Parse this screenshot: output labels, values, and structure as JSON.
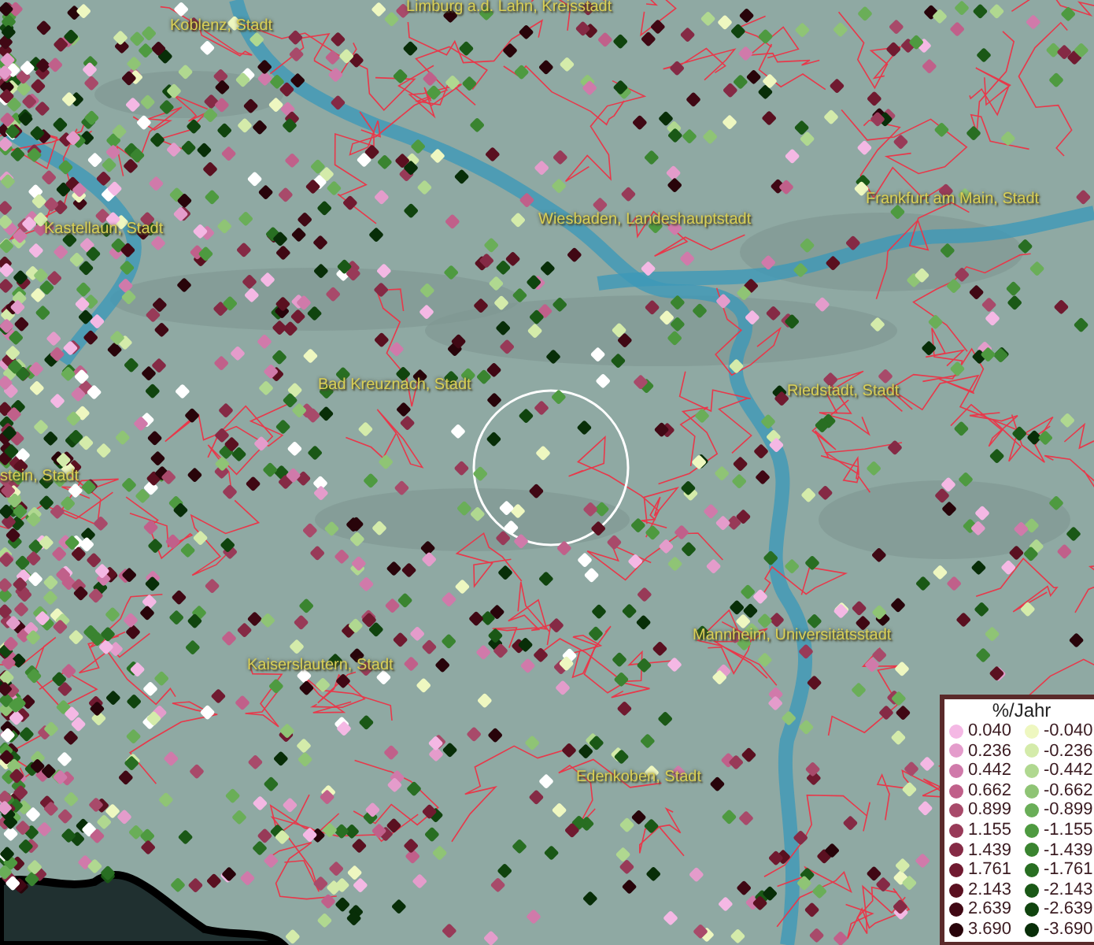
{
  "map": {
    "place_labels": [
      {
        "text": "Koblenz, Stadt"
      },
      {
        "text": "Limburg a.d. Lahn, Kreisstadt"
      },
      {
        "text": "Kastellaun, Stadt"
      },
      {
        "text": "Wiesbaden, Landeshauptstadt"
      },
      {
        "text": "Frankfurt am Main, Stadt"
      },
      {
        "text": "Bad Kreuznach, Stadt"
      },
      {
        "text": "Riedstadt, Stadt"
      },
      {
        "text": "stein, Stadt"
      },
      {
        "text": "Mannheim, Universitätsstadt"
      },
      {
        "text": "Kaiserslautern, Stadt"
      },
      {
        "text": "Edenkoben, Stadt"
      }
    ]
  },
  "legend": {
    "title": "%/Jahr",
    "positive": [
      {
        "label": "0.040",
        "color": "#f4b8e4"
      },
      {
        "label": "0.236",
        "color": "#e49ccb"
      },
      {
        "label": "0.442",
        "color": "#d07aaa"
      },
      {
        "label": "0.662",
        "color": "#c0608a"
      },
      {
        "label": "0.899",
        "color": "#a84a6a"
      },
      {
        "label": "1.155",
        "color": "#983a58"
      },
      {
        "label": "1.439",
        "color": "#852a45"
      },
      {
        "label": "1.761",
        "color": "#701a30"
      },
      {
        "label": "2.143",
        "color": "#5a1020"
      },
      {
        "label": "2.639",
        "color": "#400814"
      },
      {
        "label": "3.690",
        "color": "#28040a"
      }
    ],
    "negative": [
      {
        "label": "-0.040",
        "color": "#eef7c0"
      },
      {
        "label": "-0.236",
        "color": "#d4ebaa"
      },
      {
        "label": "-0.442",
        "color": "#b0d890"
      },
      {
        "label": "-0.662",
        "color": "#8fc475"
      },
      {
        "label": "-0.899",
        "color": "#6aae58"
      },
      {
        "label": "-1.155",
        "color": "#4e9a40"
      },
      {
        "label": "-1.439",
        "color": "#3a8430"
      },
      {
        "label": "-1.761",
        "color": "#286e22"
      },
      {
        "label": "-2.143",
        "color": "#1a5816"
      },
      {
        "label": "-2.639",
        "color": "#10440e"
      },
      {
        "label": "-3.690",
        "color": "#082e08"
      }
    ]
  }
}
